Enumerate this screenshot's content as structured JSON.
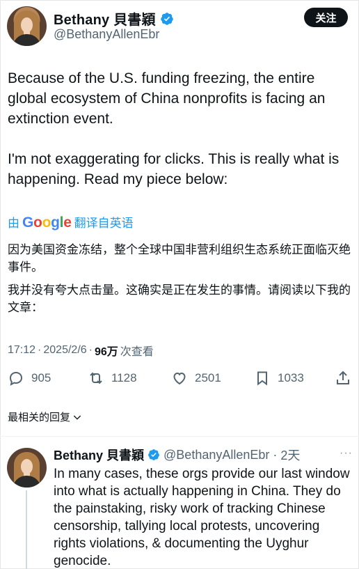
{
  "author": {
    "display_name": "Bethany 貝書穎",
    "handle": "@BethanyAllenEbr"
  },
  "follow_button_label": "关注",
  "tweet": {
    "paragraphs": [
      "Because of the U.S. funding freezing, the entire global ecosystem of China nonprofits is facing an extinction event.",
      "I'm not exaggerating for clicks. This is really what is happening. Read my piece below:"
    ],
    "translate_prefix": "由",
    "translate_suffix": "翻译自英语",
    "translation": [
      "因为美国资金冻结，整个全球中国非营利组织生态系统正面临灭绝事件。",
      "我并没有夸大点击量。这确实是正在发生的事情。请阅读以下我的文章："
    ],
    "time": "17:12",
    "date": "2025/2/6",
    "separator": "·",
    "views_count": "96万",
    "views_label": "次查看"
  },
  "actions": {
    "replies": "905",
    "retweets": "1128",
    "likes": "2501",
    "bookmarks": "1033"
  },
  "sort_label": "最相关的回复",
  "reply": {
    "display_name": "Bethany 貝書穎",
    "handle": "@BethanyAllenEbr",
    "age": "2天",
    "text": "In many cases, these orgs provide our last window into what is actually happening in China. They do the painstaking, risky work of tracking Chinese censorship, tallying local protests, uncovering rights violations, & documenting the Uyghur genocide.",
    "more": "···"
  },
  "colors": {
    "verified": "#1d9bf0",
    "text_primary": "#0f1419",
    "text_secondary": "#536471",
    "link": "#1d9bf0"
  }
}
